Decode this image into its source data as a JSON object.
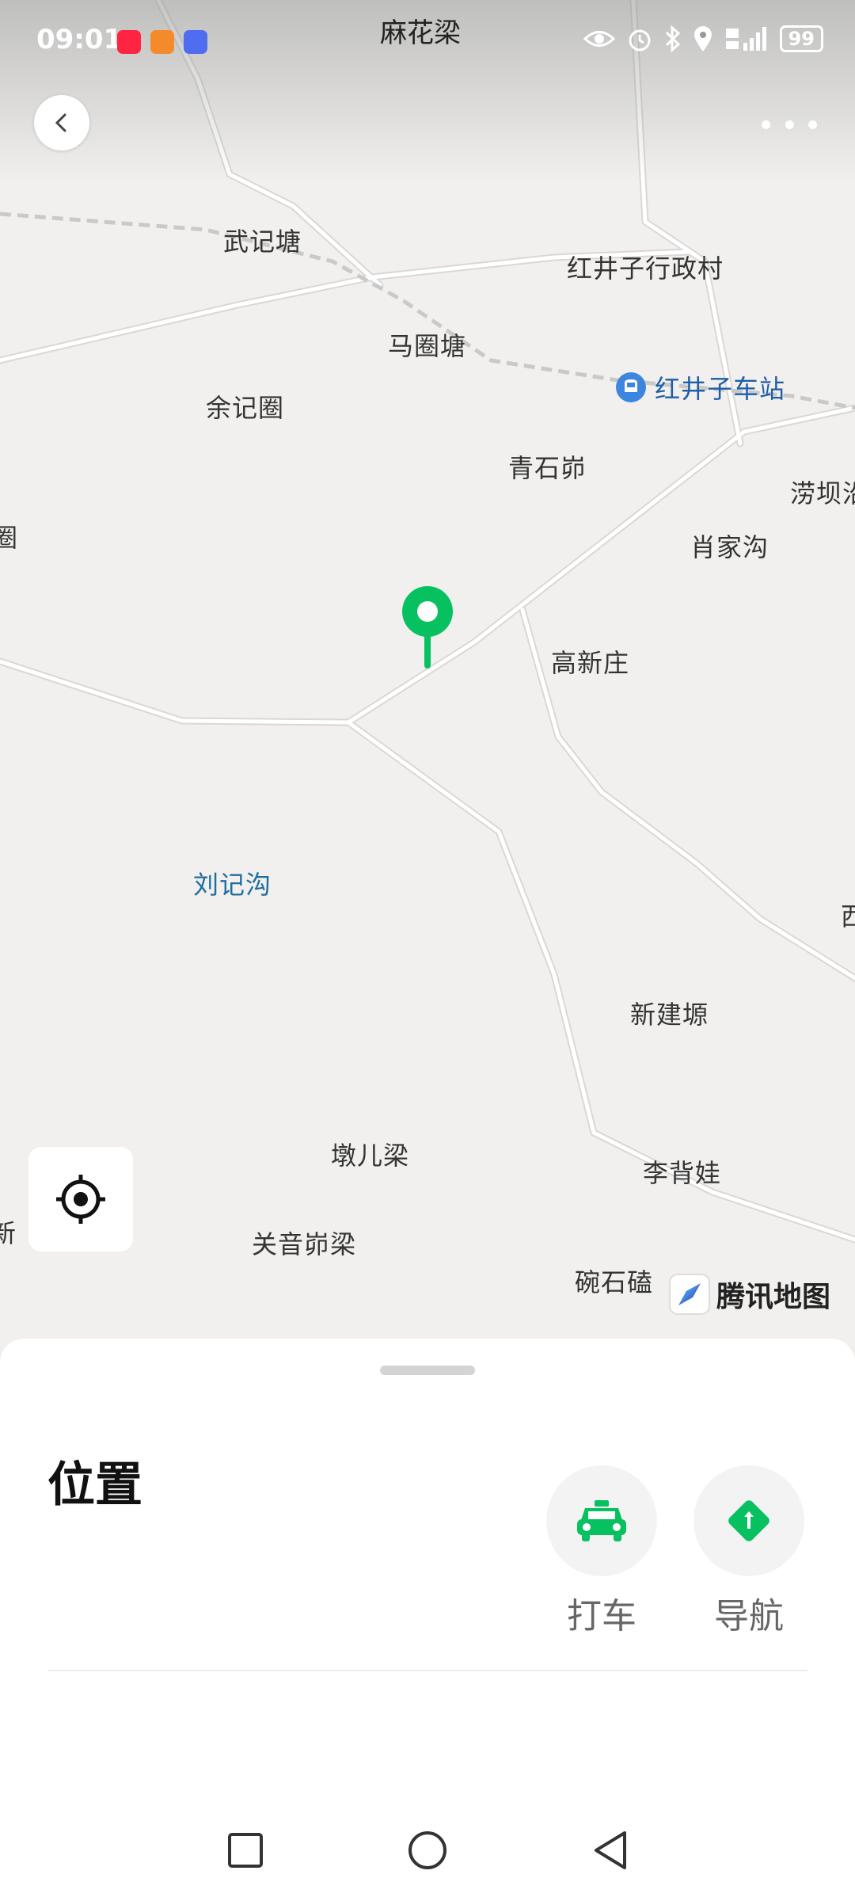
{
  "status_bar": {
    "time": "09:01",
    "battery": "99",
    "app_icons": [
      {
        "name": "xiaohongshu-icon",
        "color": "#ff2442"
      },
      {
        "name": "video-app-icon",
        "color": "#f38a2b"
      },
      {
        "name": "music-app-icon",
        "color": "#4f6df0"
      }
    ]
  },
  "map": {
    "title": "麻花梁",
    "provider": "腾讯地图",
    "labels": [
      {
        "id": "wujitang",
        "text": "武记塘",
        "type": "place"
      },
      {
        "id": "hongjingzi-village",
        "text": "红井子行政村",
        "type": "place"
      },
      {
        "id": "majuantang",
        "text": "马圈塘",
        "type": "place"
      },
      {
        "id": "hongjingzi-station",
        "text": "红井子车站",
        "type": "station"
      },
      {
        "id": "yujijuan",
        "text": "余记圈",
        "type": "place"
      },
      {
        "id": "qingshimao",
        "text": "青石峁",
        "type": "place"
      },
      {
        "id": "laobashi",
        "text": "涝坝沿",
        "type": "place"
      },
      {
        "id": "edge-left",
        "text": "圈",
        "type": "place"
      },
      {
        "id": "xiaojiagou",
        "text": "肖家沟",
        "type": "place"
      },
      {
        "id": "gaoxinzhuang",
        "text": "高新庄",
        "type": "place"
      },
      {
        "id": "liujigou",
        "text": "刘记沟",
        "type": "water"
      },
      {
        "id": "edge-right",
        "text": "西",
        "type": "place"
      },
      {
        "id": "xinjianyuan",
        "text": "新建塬",
        "type": "place"
      },
      {
        "id": "duanerliang",
        "text": "墩儿梁",
        "type": "place"
      },
      {
        "id": "libeiwa",
        "text": "李背娃",
        "type": "place"
      },
      {
        "id": "edge-left-2",
        "text": "新",
        "type": "place"
      },
      {
        "id": "guanyinmaoliang",
        "text": "关音峁梁",
        "type": "place"
      },
      {
        "id": "wanshike",
        "text": "碗石磕",
        "type": "place"
      }
    ]
  },
  "sheet": {
    "title": "位置",
    "actions": [
      {
        "label": "打车",
        "icon": "taxi-icon"
      },
      {
        "label": "导航",
        "icon": "navigation-icon"
      }
    ]
  },
  "colors": {
    "accent": "#07c160",
    "station": "#1f5fa8",
    "water_label": "#1e6e9e"
  }
}
